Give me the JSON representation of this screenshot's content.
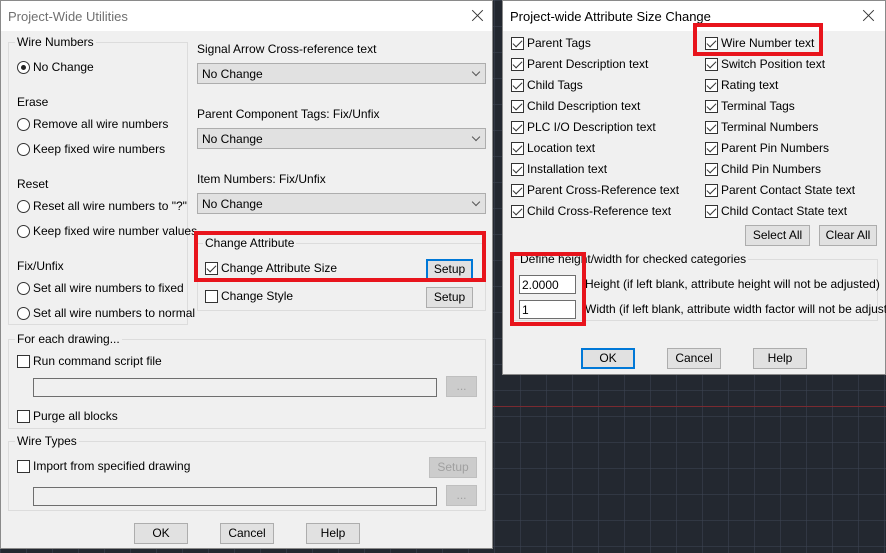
{
  "dialog1": {
    "title": "Project-Wide Utilities",
    "wire_numbers": {
      "label": "Wire Numbers",
      "no_change": "No Change",
      "erase_label": "Erase",
      "remove_all": "Remove all wire numbers",
      "keep_fixed": "Keep fixed wire numbers",
      "reset_label": "Reset",
      "reset_all": "Reset all wire numbers to \"?\"",
      "keep_fixed_values": "Keep fixed wire number values",
      "fix_label": "Fix/Unfix",
      "set_fixed": "Set all wire numbers to fixed",
      "set_normal": "Set all wire numbers to normal",
      "selected": "No Change"
    },
    "signal_arrow": {
      "label": "Signal Arrow Cross-reference text",
      "value": "No Change"
    },
    "parent_tags": {
      "label": "Parent Component Tags: Fix/Unfix",
      "value": "No Change"
    },
    "item_numbers": {
      "label": "Item Numbers: Fix/Unfix",
      "value": "No Change"
    },
    "change_attribute": {
      "label": "Change Attribute",
      "size_label": "Change Attribute Size",
      "size_checked": true,
      "style_label": "Change Style",
      "style_checked": false,
      "setup": "Setup"
    },
    "for_each": {
      "label": "For each drawing...",
      "run_script": "Run command script file",
      "script_path": "",
      "browse": "...",
      "purge": "Purge all blocks"
    },
    "wire_types": {
      "label": "Wire Types",
      "import": "Import from specified drawing",
      "setup": "Setup",
      "path": "",
      "browse": "..."
    },
    "ok": "OK",
    "cancel": "Cancel",
    "help": "Help"
  },
  "dialog2": {
    "title": "Project-wide Attribute Size Change",
    "left_items": [
      "Parent Tags",
      "Parent Description text",
      "Child Tags",
      "Child Description text",
      "PLC I/O Description text",
      "Location text",
      "Installation text",
      "Parent Cross-Reference text",
      "Child Cross-Reference text"
    ],
    "right_items": [
      "Wire Number text",
      "Switch Position text",
      "Rating text",
      "Terminal Tags",
      "Terminal Numbers",
      "Parent Pin Numbers",
      "Child Pin Numbers",
      "Parent Contact State text",
      "Child Contact State text"
    ],
    "all_checked": true,
    "select_all": "Select All",
    "clear_all": "Clear All",
    "define_label": "Define height/width for checked categories",
    "height_value": "2.0000",
    "height_label": "Height (if left blank, attribute height will not be adjusted)",
    "width_value": "1",
    "width_label": "Width (if left blank, attribute width factor will not be adjusted)",
    "ok": "OK",
    "cancel": "Cancel",
    "help": "Help"
  }
}
